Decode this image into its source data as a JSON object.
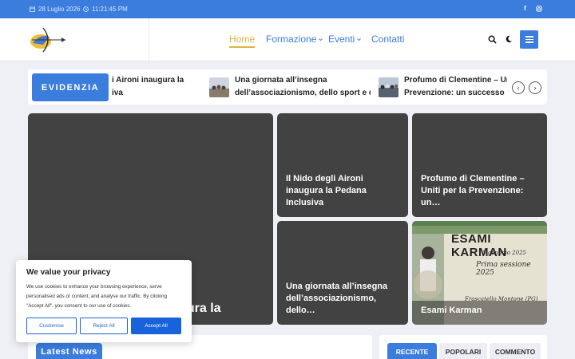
{
  "topbar": {
    "date": "28 Luglio 2026",
    "time": "11:21:45 PM",
    "social": [
      "facebook-icon",
      "instagram-icon"
    ]
  },
  "nav": {
    "items": [
      {
        "label": "Home",
        "active": true
      },
      {
        "label": "Formazione",
        "dropdown": true
      },
      {
        "label": "Eventi",
        "dropdown": true
      },
      {
        "label": "Contatti"
      }
    ]
  },
  "ticker": {
    "label": "EVIDENZIA",
    "items": [
      {
        "line1": "i Aironi inaugura la",
        "line2": "iva"
      },
      {
        "line1": " Una giornata all’insegna",
        "line2": "dell’associazionismo, dello sport e del…"
      },
      {
        "line1": " Profumo di Clementine – Un",
        "line2": "Prevenzione: un successo per s"
      }
    ]
  },
  "cards": {
    "big": " Il Nido degli Aironi inaugura la",
    "top_mid": " Il Nido degli Aironi inaugura la Pedana Inclusiva",
    "top_right": " Profumo di Clementine – Uniti per la Prevenzione: un…",
    "bottom_mid": " Una giornata all’insegna dell’associazionismo, dello…",
    "bottom_right": "Esami Karman",
    "poster_title": "ESAMI KARMAN",
    "poster_date": "5 gennaio 2025",
    "poster_session": "Prima sessione 2025",
    "poster_place": "Frascatello Montone (PG)"
  },
  "cookie": {
    "title": "We value your privacy",
    "text": "We use cookies to enhance your browsing experience, serve personalised ads or content, and analyse our traffic. By clicking \"Accept All\", you consent to our use of cookies.",
    "customise": "Customise",
    "reject": "Reject All",
    "accept": "Accept All"
  },
  "latest": {
    "label": "Latest News"
  },
  "sidebar_tabs": [
    "RECENTE",
    "POPOLARI",
    "COMMENTO"
  ],
  "colors": {
    "accent": "#3b7ddd",
    "active_nav": "#e0b341",
    "card_bg": "#424242",
    "cookie_button": "#1863dc"
  }
}
